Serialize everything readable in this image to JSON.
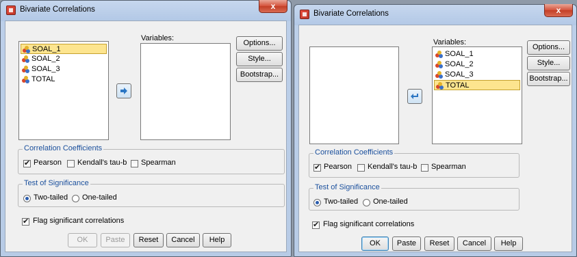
{
  "dialog_before": {
    "title": "Bivariate Correlations",
    "close_label": "x",
    "source_vars": [
      "SOAL_1",
      "SOAL_2",
      "SOAL_3",
      "TOTAL"
    ],
    "selected_source": "SOAL_1",
    "variables_label": "Variables:",
    "target_vars": [],
    "side_buttons": {
      "options": "Options...",
      "style": "Style...",
      "bootstrap": "Bootstrap..."
    },
    "coefficients": {
      "title": "Correlation Coefficients",
      "pearson": "Pearson",
      "pearson_checked": true,
      "kendall": "Kendall's tau-b",
      "kendall_checked": false,
      "spearman": "Spearman",
      "spearman_checked": false
    },
    "significance": {
      "title": "Test of Significance",
      "two_tailed": "Two-tailed",
      "one_tailed": "One-tailed",
      "selected": "Two-tailed"
    },
    "flag": {
      "label": "Flag significant correlations",
      "checked": true
    },
    "bottom_buttons": {
      "ok": "OK",
      "paste": "Paste",
      "reset": "Reset",
      "cancel": "Cancel",
      "help": "Help",
      "ok_enabled": false,
      "paste_enabled": false
    }
  },
  "dialog_after": {
    "title": "Bivariate Correlations",
    "close_label": "x",
    "source_vars": [],
    "variables_label": "Variables:",
    "target_vars": [
      "SOAL_1",
      "SOAL_2",
      "SOAL_3",
      "TOTAL"
    ],
    "selected_target": "TOTAL",
    "side_buttons": {
      "options": "Options...",
      "style": "Style...",
      "bootstrap": "Bootstrap..."
    },
    "coefficients": {
      "title": "Correlation Coefficients",
      "pearson": "Pearson",
      "pearson_checked": true,
      "kendall": "Kendall's tau-b",
      "kendall_checked": false,
      "spearman": "Spearman",
      "spearman_checked": false
    },
    "significance": {
      "title": "Test of Significance",
      "two_tailed": "Two-tailed",
      "one_tailed": "One-tailed",
      "selected": "Two-tailed"
    },
    "flag": {
      "label": "Flag significant correlations",
      "checked": true
    },
    "bottom_buttons": {
      "ok": "OK",
      "paste": "Paste",
      "reset": "Reset",
      "cancel": "Cancel",
      "help": "Help",
      "ok_enabled": true,
      "paste_enabled": true
    }
  },
  "colors": {
    "selection": "#fde58f",
    "group_title": "#1a4f9c",
    "close_button": "#c33e26"
  }
}
